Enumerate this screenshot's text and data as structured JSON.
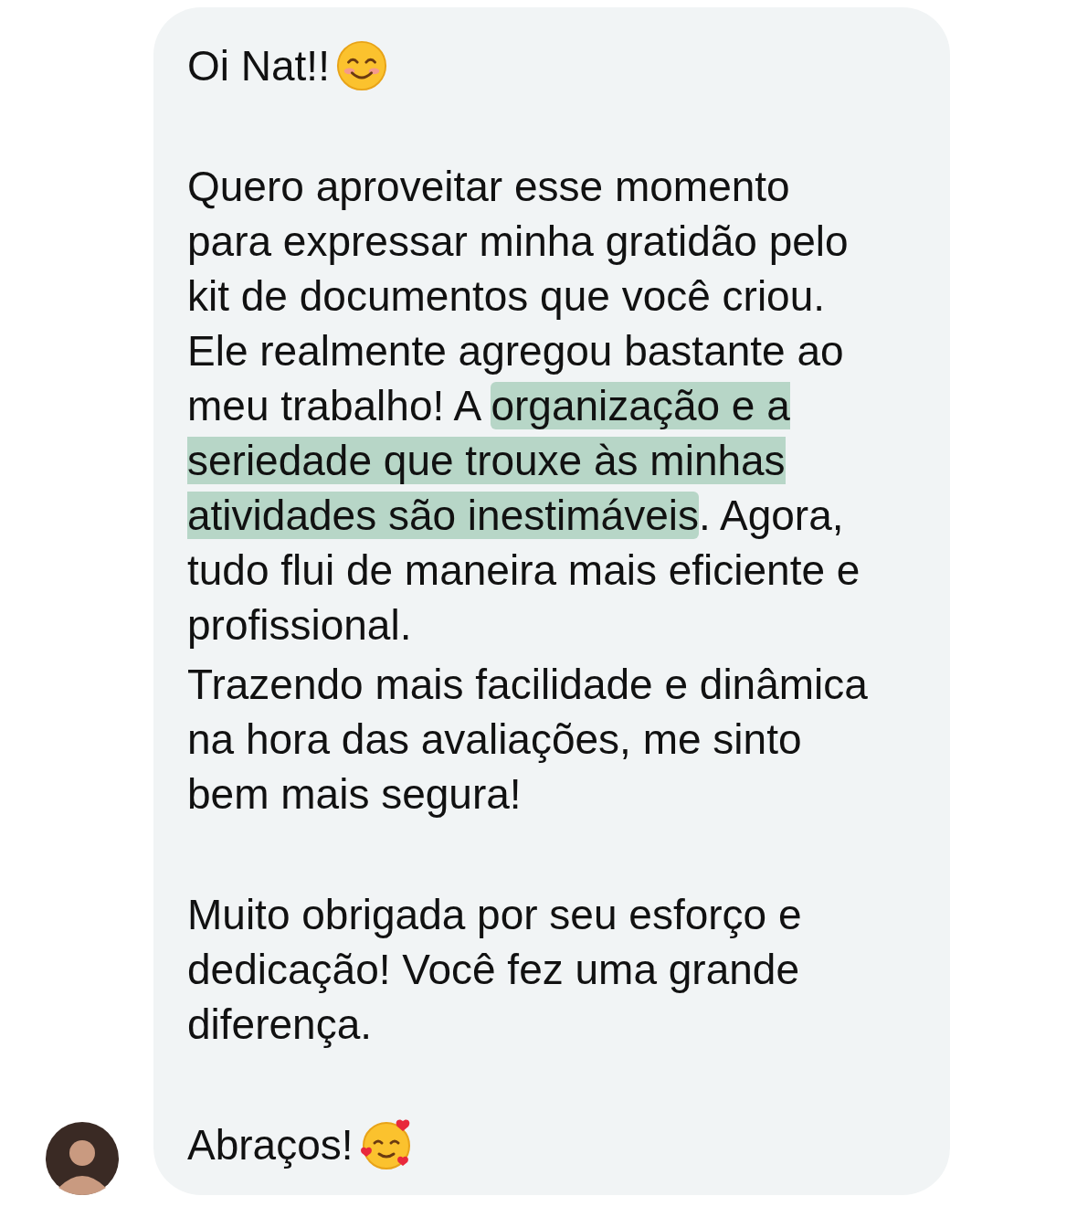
{
  "message": {
    "paragraphs": [
      {
        "kind": "text",
        "smile_icon": true,
        "hearts_icon": false,
        "segments": [
          {
            "text": "Oi Nat!!",
            "highlighted": false
          }
        ]
      },
      {
        "kind": "text_after_blank",
        "smile_icon": false,
        "hearts_icon": false,
        "segments": [
          {
            "text": "Quero aproveitar esse momento para expressar minha gratidão pelo kit de documentos que você criou. Ele realmente agregou bastante ao meu trabalho! A ",
            "highlighted": false
          },
          {
            "text": "organização e a seriedade que trouxe às minhas atividades são inestimáveis",
            "highlighted": true
          },
          {
            "text": ". Agora, tudo flui de maneira mais eficiente e profissional.",
            "highlighted": false
          }
        ]
      },
      {
        "kind": "text",
        "smile_icon": false,
        "hearts_icon": false,
        "segments": [
          {
            "text": "Trazendo mais facilidade e dinâmica na hora das avaliações, me sinto bem mais segura!",
            "highlighted": false
          }
        ]
      },
      {
        "kind": "text_after_blank",
        "smile_icon": false,
        "hearts_icon": false,
        "segments": [
          {
            "text": "Muito obrigada por seu esforço e dedicação! Você fez uma grande diferença.",
            "highlighted": false
          }
        ]
      },
      {
        "kind": "text_after_blank",
        "smile_icon": false,
        "hearts_icon": true,
        "segments": [
          {
            "text": "Abraços!",
            "highlighted": false
          }
        ]
      }
    ]
  }
}
